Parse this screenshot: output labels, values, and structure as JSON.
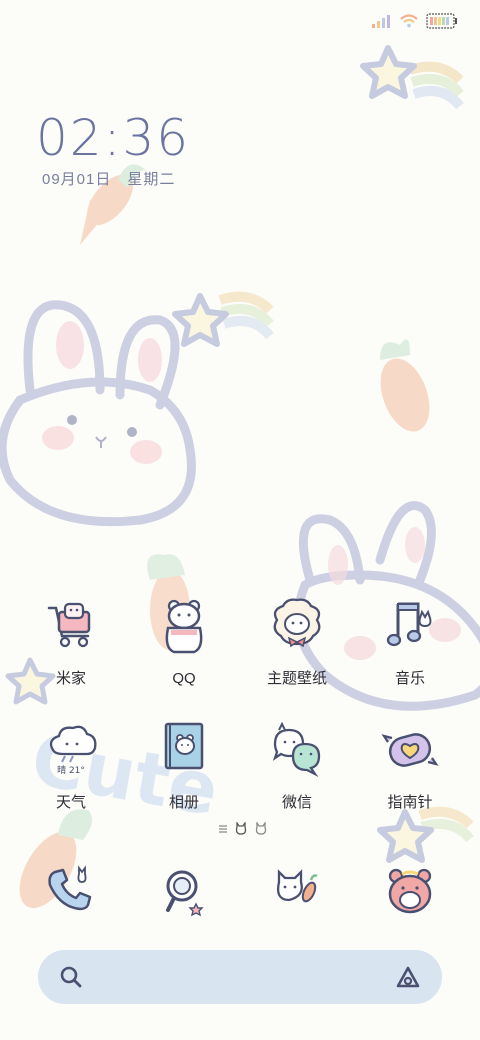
{
  "clock": {
    "time": "02:36",
    "date": "09月01日",
    "weekday": "星期二"
  },
  "apps": [
    {
      "label": "米家",
      "icon": "shopping-cart-icon"
    },
    {
      "label": "QQ",
      "icon": "qq-bear-icon"
    },
    {
      "label": "主题壁纸",
      "icon": "theme-sheep-icon"
    },
    {
      "label": "音乐",
      "icon": "music-note-icon"
    },
    {
      "label": "天气",
      "icon": "weather-cloud-icon",
      "badge": "晴 21°"
    },
    {
      "label": "相册",
      "icon": "album-book-icon"
    },
    {
      "label": "微信",
      "icon": "wechat-bubbles-icon"
    },
    {
      "label": "指南针",
      "icon": "candy-compass-icon"
    }
  ],
  "dock": [
    {
      "icon": "phone-icon"
    },
    {
      "icon": "magnifier-camera-icon"
    },
    {
      "icon": "bunny-message-icon"
    },
    {
      "icon": "bear-browser-icon"
    }
  ],
  "wallpaper_text": "Cute",
  "colors": {
    "accent": "#6b74a0",
    "search_bg": "#d9e4f1",
    "outline": "#4a5170"
  }
}
